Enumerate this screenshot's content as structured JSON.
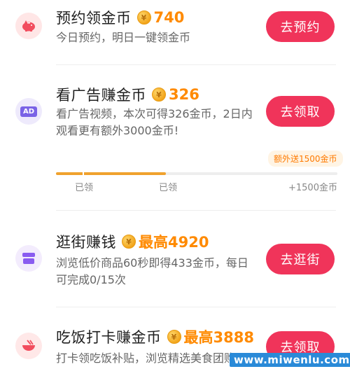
{
  "tasks": [
    {
      "title": "预约领金币",
      "coin_symbol": "¥",
      "amount": "740",
      "desc": "今日预约，明日一键领金币",
      "button": "去预约",
      "icon": "piggy-bank-icon",
      "icon_bg": "#ffe6e6"
    },
    {
      "title": "看广告赚金币",
      "coin_symbol": "¥",
      "amount": "326",
      "desc": "看广告视频，本次可得326金币，2日内观看更有额外3000金币!",
      "button": "去领取",
      "icon": "ad-icon",
      "icon_label": "AD",
      "icon_bg": "#eeeafc",
      "progress": {
        "bubble": "额外送1500金币",
        "fill_fraction": 0.39,
        "labels": [
          "已领",
          "已领",
          "+1500金币"
        ]
      }
    },
    {
      "title": "逛街赚钱",
      "coin_symbol": "¥",
      "amount": "最高4920",
      "desc": "浏览低价商品60秒即得433金币，每日可完成0/15次",
      "button": "去逛街",
      "icon": "shop-icon",
      "icon_bg": "#f3ecfd"
    },
    {
      "title": "吃饭打卡赚金币",
      "coin_symbol": "¥",
      "amount": "最高3888",
      "desc": "打卡领吃饭补贴，浏览精选美食团购",
      "button": "去领取",
      "icon": "bowl-icon",
      "icon_bg": "#ffe8e8"
    }
  ],
  "watermark": "www.miwenlu.com",
  "colors": {
    "button": "#f0345a",
    "amount": "#ff8a00",
    "progress": "#f0a22e"
  }
}
